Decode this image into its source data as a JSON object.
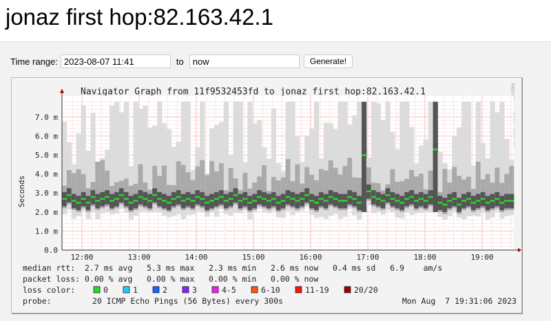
{
  "page_title": "jonaz first hop:82.163.42.1",
  "form": {
    "label": "Time range:",
    "from_value": "2023-08-07 11:41",
    "to_label": "to",
    "to_value": "now",
    "button": "Generate!"
  },
  "graph": {
    "title": "Navigator Graph from 11f9532453fd to jonaz first hop:82.163.42.1",
    "ylabel": "Seconds",
    "side_label": "RRDTOOL / TOBI OETIKER",
    "yticks": [
      "0.0",
      "1.0 m",
      "2.0 m",
      "3.0 m",
      "4.0 m",
      "5.0 m",
      "6.0 m",
      "7.0 m"
    ],
    "xticks": [
      "12:00",
      "13:00",
      "14:00",
      "15:00",
      "16:00",
      "17:00",
      "18:00",
      "19:00"
    ],
    "legend": {
      "rtt": "median rtt:  2.7 ms avg   5.3 ms max   2.3 ms min   2.6 ms now   0.4 ms sd   6.9    am/s",
      "loss": "packet loss: 0.00 % avg   0.00 % max   0.00 % min   0.00 % now",
      "loss_label": "loss color:",
      "loss_colors": [
        {
          "label": "0",
          "color": "#22dd22"
        },
        {
          "label": "1",
          "color": "#22ccff"
        },
        {
          "label": "2",
          "color": "#1166ff"
        },
        {
          "label": "3",
          "color": "#8822ff"
        },
        {
          "label": "4-5",
          "color": "#ee22ee"
        },
        {
          "label": "6-10",
          "color": "#ff5511"
        },
        {
          "label": "11-19",
          "color": "#ff1111"
        },
        {
          "label": "20/20",
          "color": "#990000"
        }
      ],
      "probe_label": "probe:",
      "probe": "20 ICMP Echo Pings (56 Bytes) every 300s",
      "timestamp": "Mon Aug  7 19:31:06 2023"
    }
  },
  "chart_data": {
    "type": "smoke",
    "start": "11:39",
    "end": "19:34",
    "ylim": [
      0,
      7.8
    ],
    "unit": "ms",
    "median_ms": [
      2.7,
      2.9,
      2.6,
      2.5,
      2.7,
      2.5,
      2.8,
      2.6,
      2.7,
      2.8,
      2.6,
      2.7,
      2.9,
      2.7,
      2.5,
      2.6,
      2.8,
      2.7,
      2.6,
      2.9,
      2.7,
      2.6,
      2.5,
      2.7,
      2.8,
      2.6,
      2.7,
      2.6,
      2.8,
      2.7,
      2.5,
      2.6,
      2.7,
      2.8,
      2.6,
      2.7,
      2.9,
      2.6,
      2.7,
      2.5,
      2.6,
      2.8,
      2.7,
      2.6,
      2.7,
      2.5,
      2.6,
      2.8,
      2.7,
      2.6,
      2.7,
      2.9,
      2.6,
      2.5,
      2.7,
      2.6,
      2.8,
      2.7,
      2.6,
      2.6,
      2.8,
      2.7,
      2.5,
      5.0,
      3.1,
      2.8,
      2.7,
      2.6,
      2.9,
      2.7,
      2.6,
      2.5,
      2.7,
      2.8,
      2.6,
      2.7,
      2.6,
      2.8,
      5.3,
      2.5,
      2.4,
      2.6,
      2.7,
      2.4,
      2.6,
      2.7,
      2.5,
      2.6,
      2.7,
      2.5,
      2.6,
      2.7,
      2.5,
      2.6,
      2.6
    ]
  }
}
